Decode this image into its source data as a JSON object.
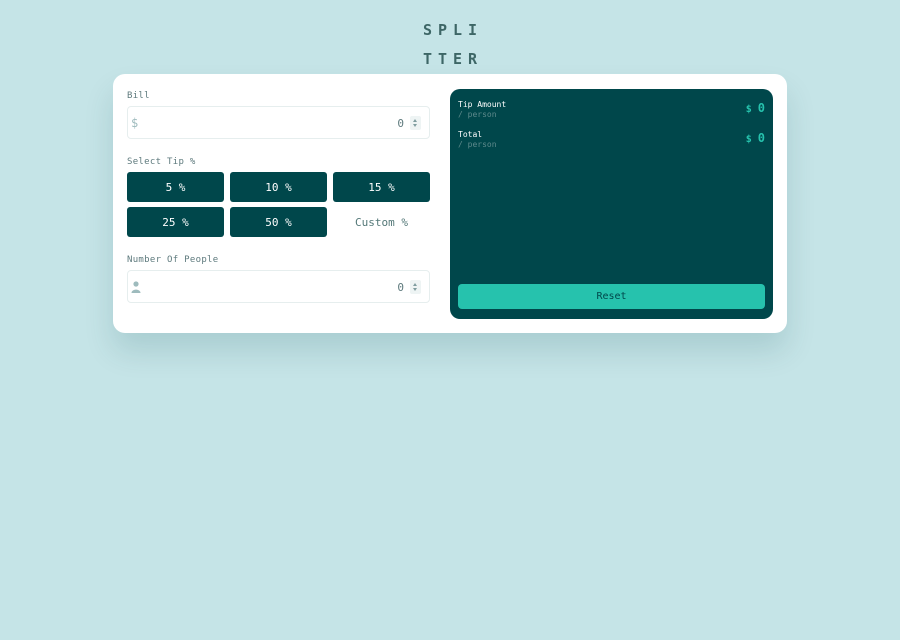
{
  "logo": {
    "line1": "SPLI",
    "line2": "TTER"
  },
  "bill": {
    "label": "Bill",
    "currency": "$",
    "placeholder": "0"
  },
  "tip": {
    "label": "Select Tip %",
    "options": [
      "5 %",
      "10 %",
      "15 %",
      "25 %",
      "50 %"
    ],
    "custom": "Custom %"
  },
  "people": {
    "label": "Number Of People",
    "placeholder": "0"
  },
  "results": {
    "tip_amount": {
      "title": "Tip Amount",
      "sub": "/ person",
      "currency": "$",
      "value": "0"
    },
    "total": {
      "title": "Total",
      "sub": "/ person",
      "currency": "$",
      "value": "0"
    },
    "reset_label": "Reset"
  },
  "icons": {
    "person": "person-icon",
    "spinner": "spinner-arrows-icon"
  },
  "colors": {
    "background": "#c5e4e7",
    "dark": "#00474b",
    "accent": "#26c2ad",
    "card": "#ffffff"
  }
}
